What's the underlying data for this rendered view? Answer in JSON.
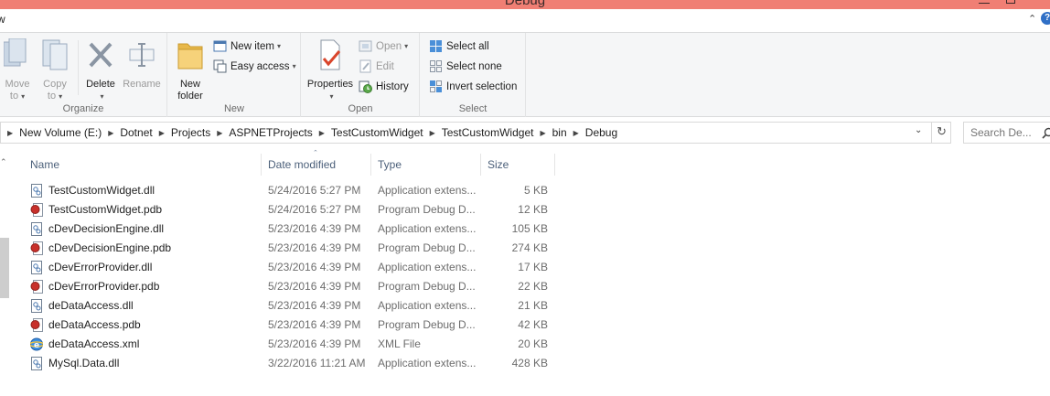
{
  "window": {
    "title": "Debug"
  },
  "tabs": {
    "view_partial": "w"
  },
  "ribbon": {
    "organize": {
      "label": "Organize",
      "move_to": [
        "Move",
        "to"
      ],
      "copy_to": [
        "Copy",
        "to"
      ],
      "delete": "Delete",
      "rename": "Rename"
    },
    "new": {
      "label": "New",
      "new_folder": [
        "New",
        "folder"
      ],
      "new_item": "New item",
      "easy_access": "Easy access"
    },
    "open": {
      "label": "Open",
      "properties": "Properties",
      "open": "Open",
      "edit": "Edit",
      "history": "History"
    },
    "select": {
      "label": "Select",
      "select_all": "Select all",
      "select_none": "Select none",
      "invert": "Invert selection"
    }
  },
  "address": {
    "crumbs": [
      "New Volume (E:)",
      "Dotnet",
      "Projects",
      "ASPNETProjects",
      "TestCustomWidget",
      "TestCustomWidget",
      "bin",
      "Debug"
    ],
    "search_placeholder": "Search De..."
  },
  "columns": {
    "name": "Name",
    "date": "Date modified",
    "type": "Type",
    "size": "Size"
  },
  "files": [
    {
      "name": "TestCustomWidget.dll",
      "date": "5/24/2016 5:27 PM",
      "type": "Application extens...",
      "size": "5 KB",
      "icon": "dll-icon"
    },
    {
      "name": "TestCustomWidget.pdb",
      "date": "5/24/2016 5:27 PM",
      "type": "Program Debug D...",
      "size": "12 KB",
      "icon": "pdb-icon"
    },
    {
      "name": "cDevDecisionEngine.dll",
      "date": "5/23/2016 4:39 PM",
      "type": "Application extens...",
      "size": "105 KB",
      "icon": "dll-icon"
    },
    {
      "name": "cDevDecisionEngine.pdb",
      "date": "5/23/2016 4:39 PM",
      "type": "Program Debug D...",
      "size": "274 KB",
      "icon": "pdb-icon"
    },
    {
      "name": "cDevErrorProvider.dll",
      "date": "5/23/2016 4:39 PM",
      "type": "Application extens...",
      "size": "17 KB",
      "icon": "dll-icon"
    },
    {
      "name": "cDevErrorProvider.pdb",
      "date": "5/23/2016 4:39 PM",
      "type": "Program Debug D...",
      "size": "22 KB",
      "icon": "pdb-icon"
    },
    {
      "name": "deDataAccess.dll",
      "date": "5/23/2016 4:39 PM",
      "type": "Application extens...",
      "size": "21 KB",
      "icon": "dll-icon"
    },
    {
      "name": "deDataAccess.pdb",
      "date": "5/23/2016 4:39 PM",
      "type": "Program Debug D...",
      "size": "42 KB",
      "icon": "pdb-icon"
    },
    {
      "name": "deDataAccess.xml",
      "date": "5/23/2016 4:39 PM",
      "type": "XML File",
      "size": "20 KB",
      "icon": "xml-icon"
    },
    {
      "name": "MySql.Data.dll",
      "date": "3/22/2016 11:21 AM",
      "type": "Application extens...",
      "size": "428 KB",
      "icon": "dll-icon"
    }
  ],
  "colors": {
    "titlebar": "#f07f74",
    "header_text": "#4c607a",
    "accent_blue": "#2f6fc6"
  }
}
